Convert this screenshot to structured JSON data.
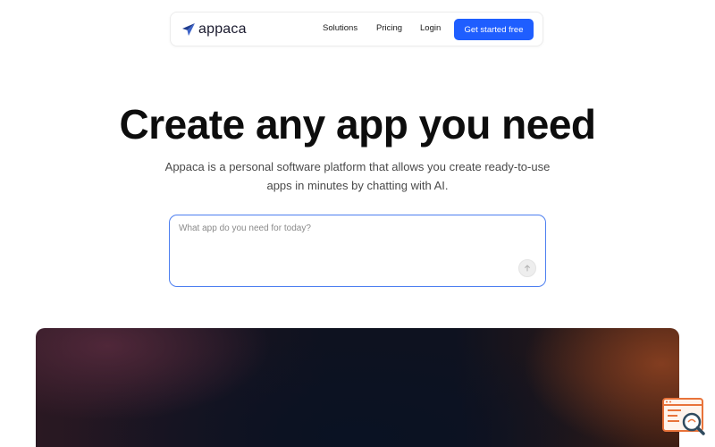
{
  "brand": {
    "name": "appaca",
    "icon": "paper-plane-icon",
    "icon_color": "#1f3c8f"
  },
  "nav": {
    "solutions": "Solutions",
    "pricing": "Pricing",
    "login": "Login",
    "cta": "Get started free",
    "cta_color": "#1f5eff"
  },
  "hero": {
    "title": "Create any app you need",
    "subtitle": "Appaca is a personal software platform that allows you create ready-to-use apps in minutes by chatting with AI."
  },
  "prompt": {
    "placeholder": "What app do you need for today?",
    "value": "",
    "send_icon": "arrow-up-icon",
    "border_color": "#4d7ff0"
  },
  "widget": {
    "icon": "search-document-icon",
    "color": "#e8733a"
  }
}
